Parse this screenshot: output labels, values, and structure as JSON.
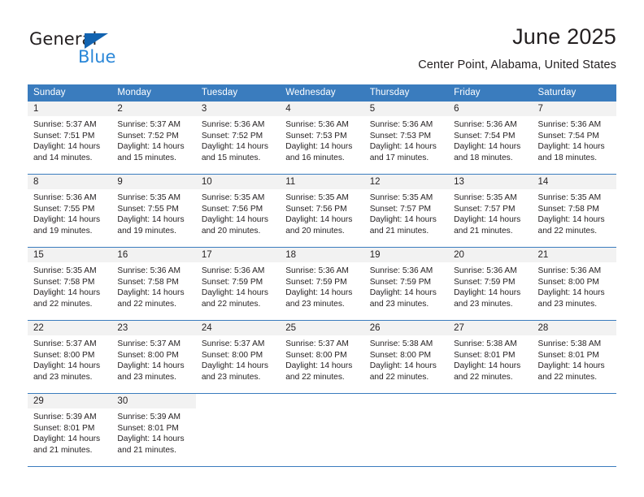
{
  "brand": {
    "name_top": "General",
    "name_bottom": "Blue",
    "triangle_color": "#1263b0",
    "blue_text_color": "#2a87d8"
  },
  "header": {
    "title": "June 2025",
    "subtitle": "Center Point, Alabama, United States"
  },
  "theme": {
    "header_blue": "#3a7cbe",
    "daynum_band": "#f2f2f2",
    "text": "#231f20"
  },
  "weekdays": [
    "Sunday",
    "Monday",
    "Tuesday",
    "Wednesday",
    "Thursday",
    "Friday",
    "Saturday"
  ],
  "weeks": [
    [
      {
        "day": "1",
        "sunrise": "Sunrise: 5:37 AM",
        "sunset": "Sunset: 7:51 PM",
        "daylight": "Daylight: 14 hours and 14 minutes."
      },
      {
        "day": "2",
        "sunrise": "Sunrise: 5:37 AM",
        "sunset": "Sunset: 7:52 PM",
        "daylight": "Daylight: 14 hours and 15 minutes."
      },
      {
        "day": "3",
        "sunrise": "Sunrise: 5:36 AM",
        "sunset": "Sunset: 7:52 PM",
        "daylight": "Daylight: 14 hours and 15 minutes."
      },
      {
        "day": "4",
        "sunrise": "Sunrise: 5:36 AM",
        "sunset": "Sunset: 7:53 PM",
        "daylight": "Daylight: 14 hours and 16 minutes."
      },
      {
        "day": "5",
        "sunrise": "Sunrise: 5:36 AM",
        "sunset": "Sunset: 7:53 PM",
        "daylight": "Daylight: 14 hours and 17 minutes."
      },
      {
        "day": "6",
        "sunrise": "Sunrise: 5:36 AM",
        "sunset": "Sunset: 7:54 PM",
        "daylight": "Daylight: 14 hours and 18 minutes."
      },
      {
        "day": "7",
        "sunrise": "Sunrise: 5:36 AM",
        "sunset": "Sunset: 7:54 PM",
        "daylight": "Daylight: 14 hours and 18 minutes."
      }
    ],
    [
      {
        "day": "8",
        "sunrise": "Sunrise: 5:36 AM",
        "sunset": "Sunset: 7:55 PM",
        "daylight": "Daylight: 14 hours and 19 minutes."
      },
      {
        "day": "9",
        "sunrise": "Sunrise: 5:35 AM",
        "sunset": "Sunset: 7:55 PM",
        "daylight": "Daylight: 14 hours and 19 minutes."
      },
      {
        "day": "10",
        "sunrise": "Sunrise: 5:35 AM",
        "sunset": "Sunset: 7:56 PM",
        "daylight": "Daylight: 14 hours and 20 minutes."
      },
      {
        "day": "11",
        "sunrise": "Sunrise: 5:35 AM",
        "sunset": "Sunset: 7:56 PM",
        "daylight": "Daylight: 14 hours and 20 minutes."
      },
      {
        "day": "12",
        "sunrise": "Sunrise: 5:35 AM",
        "sunset": "Sunset: 7:57 PM",
        "daylight": "Daylight: 14 hours and 21 minutes."
      },
      {
        "day": "13",
        "sunrise": "Sunrise: 5:35 AM",
        "sunset": "Sunset: 7:57 PM",
        "daylight": "Daylight: 14 hours and 21 minutes."
      },
      {
        "day": "14",
        "sunrise": "Sunrise: 5:35 AM",
        "sunset": "Sunset: 7:58 PM",
        "daylight": "Daylight: 14 hours and 22 minutes."
      }
    ],
    [
      {
        "day": "15",
        "sunrise": "Sunrise: 5:35 AM",
        "sunset": "Sunset: 7:58 PM",
        "daylight": "Daylight: 14 hours and 22 minutes."
      },
      {
        "day": "16",
        "sunrise": "Sunrise: 5:36 AM",
        "sunset": "Sunset: 7:58 PM",
        "daylight": "Daylight: 14 hours and 22 minutes."
      },
      {
        "day": "17",
        "sunrise": "Sunrise: 5:36 AM",
        "sunset": "Sunset: 7:59 PM",
        "daylight": "Daylight: 14 hours and 22 minutes."
      },
      {
        "day": "18",
        "sunrise": "Sunrise: 5:36 AM",
        "sunset": "Sunset: 7:59 PM",
        "daylight": "Daylight: 14 hours and 23 minutes."
      },
      {
        "day": "19",
        "sunrise": "Sunrise: 5:36 AM",
        "sunset": "Sunset: 7:59 PM",
        "daylight": "Daylight: 14 hours and 23 minutes."
      },
      {
        "day": "20",
        "sunrise": "Sunrise: 5:36 AM",
        "sunset": "Sunset: 7:59 PM",
        "daylight": "Daylight: 14 hours and 23 minutes."
      },
      {
        "day": "21",
        "sunrise": "Sunrise: 5:36 AM",
        "sunset": "Sunset: 8:00 PM",
        "daylight": "Daylight: 14 hours and 23 minutes."
      }
    ],
    [
      {
        "day": "22",
        "sunrise": "Sunrise: 5:37 AM",
        "sunset": "Sunset: 8:00 PM",
        "daylight": "Daylight: 14 hours and 23 minutes."
      },
      {
        "day": "23",
        "sunrise": "Sunrise: 5:37 AM",
        "sunset": "Sunset: 8:00 PM",
        "daylight": "Daylight: 14 hours and 23 minutes."
      },
      {
        "day": "24",
        "sunrise": "Sunrise: 5:37 AM",
        "sunset": "Sunset: 8:00 PM",
        "daylight": "Daylight: 14 hours and 23 minutes."
      },
      {
        "day": "25",
        "sunrise": "Sunrise: 5:37 AM",
        "sunset": "Sunset: 8:00 PM",
        "daylight": "Daylight: 14 hours and 22 minutes."
      },
      {
        "day": "26",
        "sunrise": "Sunrise: 5:38 AM",
        "sunset": "Sunset: 8:00 PM",
        "daylight": "Daylight: 14 hours and 22 minutes."
      },
      {
        "day": "27",
        "sunrise": "Sunrise: 5:38 AM",
        "sunset": "Sunset: 8:01 PM",
        "daylight": "Daylight: 14 hours and 22 minutes."
      },
      {
        "day": "28",
        "sunrise": "Sunrise: 5:38 AM",
        "sunset": "Sunset: 8:01 PM",
        "daylight": "Daylight: 14 hours and 22 minutes."
      }
    ],
    [
      {
        "day": "29",
        "sunrise": "Sunrise: 5:39 AM",
        "sunset": "Sunset: 8:01 PM",
        "daylight": "Daylight: 14 hours and 21 minutes."
      },
      {
        "day": "30",
        "sunrise": "Sunrise: 5:39 AM",
        "sunset": "Sunset: 8:01 PM",
        "daylight": "Daylight: 14 hours and 21 minutes."
      },
      {
        "day": "",
        "sunrise": "",
        "sunset": "",
        "daylight": ""
      },
      {
        "day": "",
        "sunrise": "",
        "sunset": "",
        "daylight": ""
      },
      {
        "day": "",
        "sunrise": "",
        "sunset": "",
        "daylight": ""
      },
      {
        "day": "",
        "sunrise": "",
        "sunset": "",
        "daylight": ""
      },
      {
        "day": "",
        "sunrise": "",
        "sunset": "",
        "daylight": ""
      }
    ]
  ]
}
